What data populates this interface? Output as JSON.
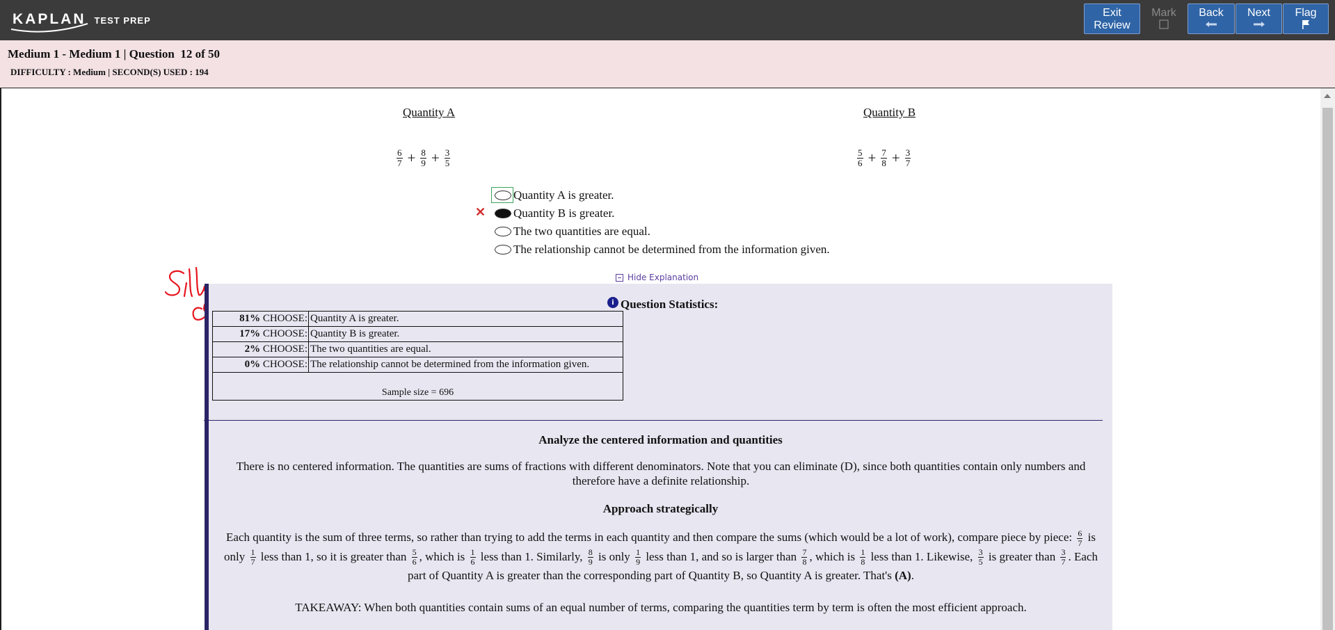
{
  "brand": {
    "logo_text": "KAPLAN",
    "tagline": "TEST PREP"
  },
  "nav": {
    "exit": {
      "line1": "Exit",
      "line2": "Review"
    },
    "mark": {
      "label": "Mark"
    },
    "back": {
      "label": "Back"
    },
    "next": {
      "label": "Next"
    },
    "flag": {
      "label": "Flag"
    }
  },
  "header": {
    "title": "Medium 1 - Medium 1 | Question  12 of 50",
    "difficulty": "DIFFICULTY : Medium | SECOND(S) USED : 194"
  },
  "question": {
    "quantity_a": {
      "label": "Quantity A",
      "fractions": [
        {
          "n": "6",
          "d": "7"
        },
        {
          "n": "8",
          "d": "9"
        },
        {
          "n": "3",
          "d": "5"
        }
      ]
    },
    "quantity_b": {
      "label": "Quantity B",
      "fractions": [
        {
          "n": "5",
          "d": "6"
        },
        {
          "n": "7",
          "d": "8"
        },
        {
          "n": "3",
          "d": "7"
        }
      ]
    },
    "plus": "+",
    "choices": [
      {
        "label": "Quantity A is greater.",
        "selected": false
      },
      {
        "label": "Quantity B is greater.",
        "selected": true
      },
      {
        "label": "The two quantities are equal.",
        "selected": false
      },
      {
        "label": "The relationship cannot be determined from the information given.",
        "selected": false
      }
    ],
    "wrong_mark": "✕",
    "handwritten_note": "Silly calculation mistake"
  },
  "explanation_toggle": {
    "label": "Hide Explanation"
  },
  "stats": {
    "heading": "Question Statistics:",
    "info_glyph": "i",
    "choose_word": "CHOOSE:",
    "rows": [
      {
        "percent": "81%",
        "label": "Quantity A is greater."
      },
      {
        "percent": "17%",
        "label": "Quantity B is greater."
      },
      {
        "percent": "2%",
        "label": "The two quantities are equal."
      },
      {
        "percent": "0%",
        "label": "The relationship cannot be determined from the information given."
      }
    ],
    "sample_size": "Sample size = 696"
  },
  "explanation": {
    "heading1": "Analyze the centered information and quantities",
    "para1": "There is no centered information. The quantities are sums of fractions with different denominators. Note that you can eliminate (D), since both quantities contain only numbers and therefore have a definite relationship.",
    "heading2": "Approach strategically",
    "para2": {
      "t1": "Each quantity is the sum of three terms, so rather than trying to add the terms in each quantity and then compare the sums (which would be a lot of work), compare piece by piece:",
      "f1": {
        "n": "6",
        "d": "7"
      },
      "t2": "is only",
      "f2": {
        "n": "1",
        "d": "7"
      },
      "t3": "less than 1, so it is greater than",
      "f3": {
        "n": "5",
        "d": "6"
      },
      "t4": ", which is",
      "f4": {
        "n": "1",
        "d": "6"
      },
      "t5": "less than 1. Similarly,",
      "f5": {
        "n": "8",
        "d": "9"
      },
      "t6": "is only",
      "f6": {
        "n": "1",
        "d": "9"
      },
      "t7": "less than 1, and so is larger than",
      "f7": {
        "n": "7",
        "d": "8"
      },
      "t8": ", which is",
      "f8": {
        "n": "1",
        "d": "8"
      },
      "t9": "less than 1. Likewise,",
      "f9": {
        "n": "3",
        "d": "5"
      },
      "t10": "is greater than",
      "f10": {
        "n": "3",
        "d": "7"
      },
      "t11": ". Each part of Quantity A is greater than the corresponding part of Quantity B, so Quantity A is greater. That's",
      "answer": "(A)",
      "t12": "."
    },
    "takeaway": "TAKEAWAY: When both quantities contain sums of an equal number of terms, comparing the quantities term by term is often the most efficient approach."
  }
}
